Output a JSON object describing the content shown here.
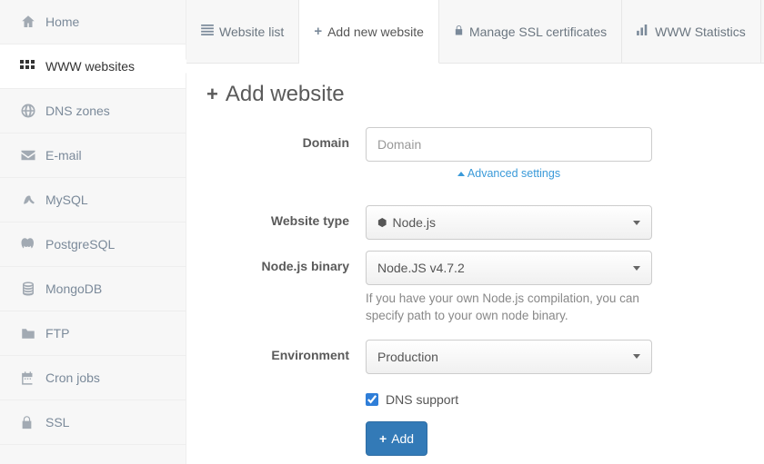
{
  "sidebar": {
    "items": [
      {
        "label": "Home"
      },
      {
        "label": "WWW websites"
      },
      {
        "label": "DNS zones"
      },
      {
        "label": "E-mail"
      },
      {
        "label": "MySQL"
      },
      {
        "label": "PostgreSQL"
      },
      {
        "label": "MongoDB"
      },
      {
        "label": "FTP"
      },
      {
        "label": "Cron jobs"
      },
      {
        "label": "SSL"
      }
    ]
  },
  "tabs": {
    "list": "Website list",
    "add": "Add new website",
    "ssl": "Manage SSL certificates",
    "stats": "WWW Statistics"
  },
  "page": {
    "title": "Add website"
  },
  "form": {
    "domain_label": "Domain",
    "domain_placeholder": "Domain",
    "advanced_link": "Advanced settings",
    "type_label": "Website type",
    "type_value": "Node.js",
    "binary_label": "Node.js binary",
    "binary_value": "Node.JS v4.7.2",
    "binary_help": "If you have your own Node.js compilation, you can specify path to your own node binary.",
    "env_label": "Environment",
    "env_value": "Production",
    "dns_label": "DNS support",
    "dns_checked": true,
    "submit": "Add"
  }
}
